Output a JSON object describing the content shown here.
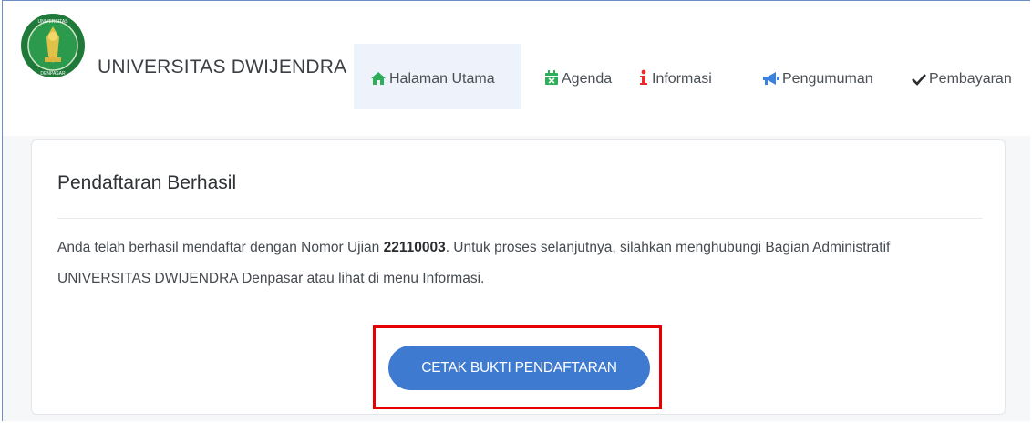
{
  "navbar": {
    "brand": "UNIVERSITAS DWIJENDRA",
    "logo_text_top": "UNIVERSITAS DWIJENDRA",
    "logo_text_bottom": "DENPASAR",
    "items": [
      {
        "label": "Halaman Utama",
        "icon": "home-icon",
        "active": true
      },
      {
        "label": "Agenda",
        "icon": "calendar-icon"
      },
      {
        "label": "Informasi",
        "icon": "info-icon"
      },
      {
        "label": "Pengumuman",
        "icon": "megaphone-icon"
      },
      {
        "label": "Pembayaran",
        "icon": "checkmark-icon"
      }
    ]
  },
  "card": {
    "title": "Pendaftaran Berhasil",
    "message_before": "Anda telah berhasil mendaftar dengan Nomor Ujian ",
    "exam_number": "22110003",
    "message_after": ". Untuk proses selanjutnya, silahkan menghubungi Bagian Administratif UNIVERSITAS DWIJENDRA Denpasar atau lihat di menu Informasi.",
    "button_label": "CETAK BUKTI PENDAFTARAN"
  },
  "colors": {
    "accent": "#3f7ad1",
    "active_nav_bg": "#eef3fb",
    "icon_green": "#2fae5a",
    "icon_red": "#e52b2b",
    "icon_blue": "#3b82e0",
    "highlight": "#e60000"
  }
}
